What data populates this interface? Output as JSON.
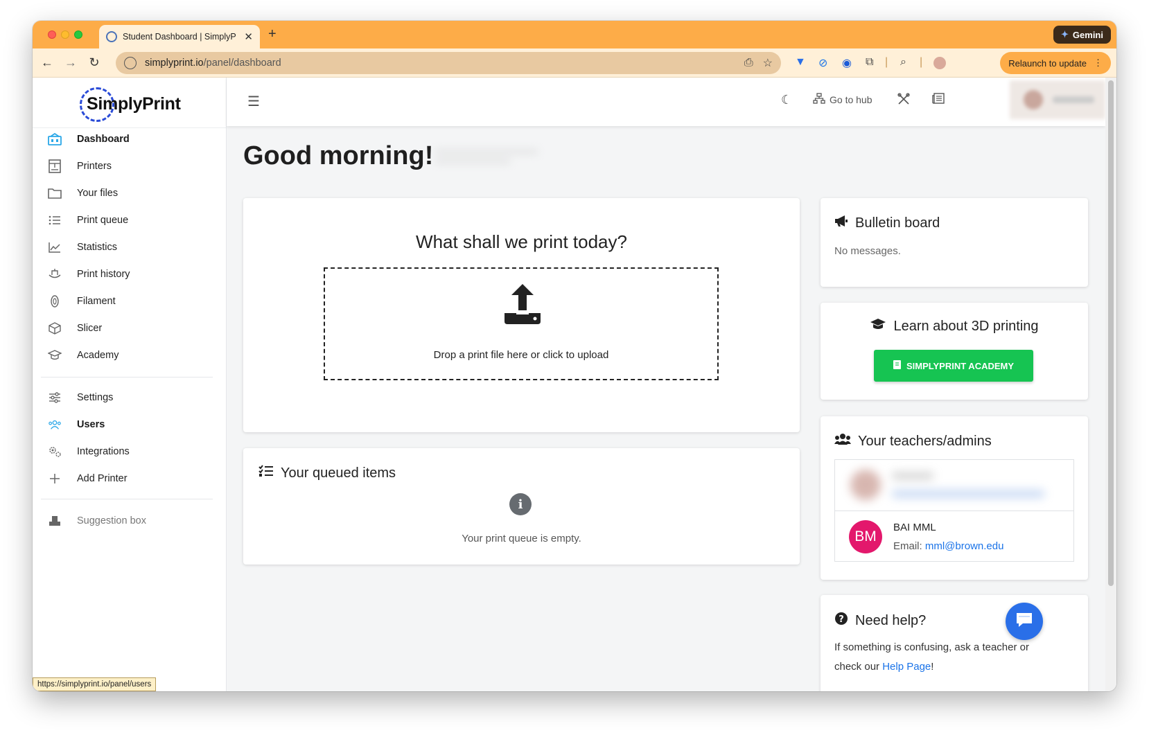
{
  "browser": {
    "tab_title": "Student Dashboard | SimplyP",
    "new_tab": "+",
    "gemini_label": "Gemini",
    "url_host": "simplyprint.io",
    "url_path": "/panel/dashboard",
    "relaunch_label": "Relaunch to update",
    "status_url": "https://simplyprint.io/panel/users"
  },
  "logo": {
    "text": "SimplyPrint"
  },
  "sidebar": {
    "items": [
      {
        "label": "Dashboard",
        "icon": "dashboard-icon"
      },
      {
        "label": "Printers",
        "icon": "printer-icon"
      },
      {
        "label": "Your files",
        "icon": "folder-icon"
      },
      {
        "label": "Print queue",
        "icon": "list-icon"
      },
      {
        "label": "Statistics",
        "icon": "chart-icon"
      },
      {
        "label": "Print history",
        "icon": "history-icon"
      },
      {
        "label": "Filament",
        "icon": "filament-icon"
      },
      {
        "label": "Slicer",
        "icon": "cube-icon"
      },
      {
        "label": "Academy",
        "icon": "graduation-cap-icon"
      }
    ],
    "admin_items": [
      {
        "label": "Settings",
        "icon": "sliders-icon"
      },
      {
        "label": "Users",
        "icon": "users-icon"
      },
      {
        "label": "Integrations",
        "icon": "gears-icon"
      },
      {
        "label": "Add Printer",
        "icon": "plus-icon"
      }
    ],
    "suggestion": {
      "label": "Suggestion box",
      "icon": "inbox-icon"
    }
  },
  "topbar": {
    "go_to_hub": "Go to hub"
  },
  "main": {
    "greeting": "Good morning!",
    "upload": {
      "title": "What shall we print today?",
      "drop_text": "Drop a print file here or click to upload"
    },
    "queue": {
      "title": "Your queued items",
      "empty_text": "Your print queue is empty."
    },
    "bulletin": {
      "title": "Bulletin board",
      "text": "No messages."
    },
    "learn": {
      "title": "Learn about 3D printing",
      "button": "SIMPLYPRINT ACADEMY"
    },
    "teachers": {
      "title": "Your teachers/admins",
      "teacher": {
        "initials": "BM",
        "name": "BAI MML",
        "email_label": "Email:",
        "email": "mml@brown.edu"
      }
    },
    "help": {
      "title": "Need help?",
      "text_before": "If something is confusing, ask a teacher or check our ",
      "link": "Help Page",
      "text_after": "!"
    }
  },
  "colors": {
    "accent": "#2aa7e8",
    "academy_green": "#16c452",
    "avatar_pink": "#e3186c",
    "link_blue": "#1a73e8",
    "chrome_orange": "#fdac48"
  }
}
